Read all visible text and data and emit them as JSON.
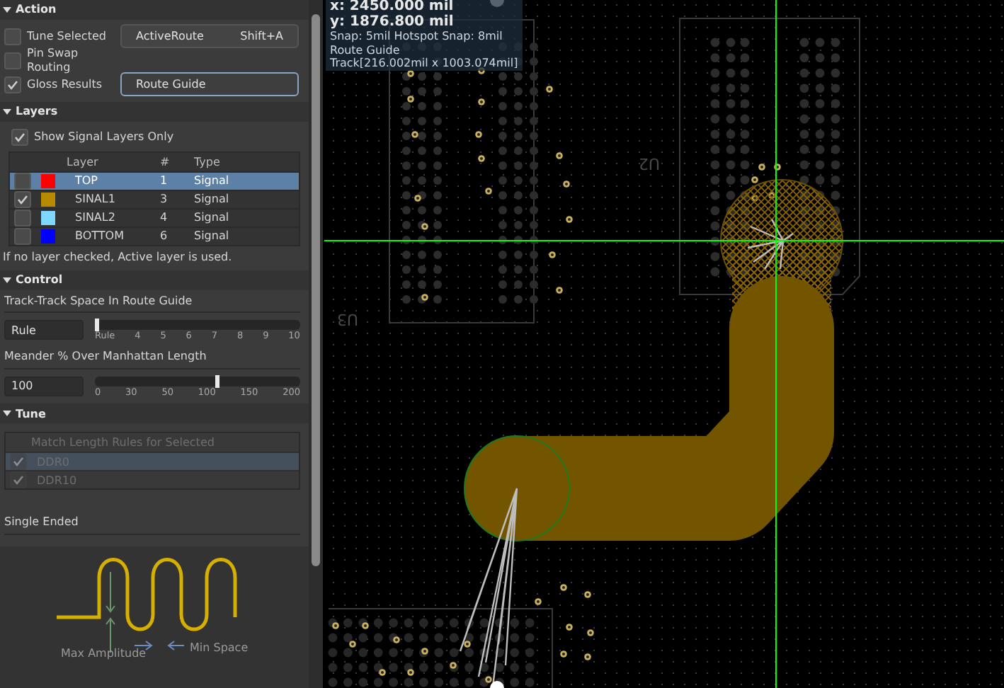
{
  "action": {
    "title": "Action",
    "expanded": true,
    "options": [
      {
        "label": "Tune Selected",
        "checked": false
      },
      {
        "label": "Pin Swap Routing",
        "checked": false
      },
      {
        "label": "Gloss Results",
        "checked": true
      }
    ],
    "buttons": [
      {
        "label": "ActiveRoute",
        "shortcut": "Shift+A",
        "selected": false
      },
      {
        "label": "Route Guide",
        "selected": true
      }
    ]
  },
  "layers": {
    "title": "Layers",
    "expanded": true,
    "show_signal_only": {
      "label": "Show Signal Layers Only",
      "checked": true
    },
    "columns": [
      "Layer",
      "#",
      "Type"
    ],
    "rows": [
      {
        "checked": false,
        "color": "#ff0000",
        "name": "TOP",
        "number": "1",
        "type": "Signal",
        "selected": true
      },
      {
        "checked": true,
        "color": "#b88a00",
        "name": "SINAL1",
        "number": "3",
        "type": "Signal",
        "selected": false
      },
      {
        "checked": false,
        "color": "#7fd8ff",
        "name": "SINAL2",
        "number": "4",
        "type": "Signal",
        "selected": false
      },
      {
        "checked": false,
        "color": "#0000ff",
        "name": "BOTTOM",
        "number": "6",
        "type": "Signal",
        "selected": false
      }
    ],
    "note": "If no layer checked, Active layer is used."
  },
  "control": {
    "title": "Control",
    "expanded": true,
    "settings": [
      {
        "label": "Track-Track Space In Route Guide",
        "value": "Rule",
        "level": 0,
        "ticks": [
          "Rule",
          "4",
          "5",
          "6",
          "7",
          "8",
          "9",
          "10"
        ]
      },
      {
        "label": "Meander % Over Manhattan Length",
        "value": "100",
        "level": 0.6,
        "ticks": [
          "0",
          "30",
          "50",
          "100",
          "150",
          "200"
        ]
      }
    ]
  },
  "tune": {
    "title": "Tune",
    "expanded": true,
    "disabled": true,
    "column": "Match Length Rules for Selected",
    "rows": [
      {
        "name": "DDR0",
        "checked": true,
        "selected": true
      },
      {
        "name": "DDR10",
        "checked": true,
        "selected": false
      }
    ],
    "mode": "Single Ended",
    "diagram_labels": [
      "Max Amplitude",
      "Min Space"
    ]
  },
  "canvas": {
    "readout": [
      "x:  2450.000 mil",
      "y:  1876.800 mil"
    ],
    "info": [
      "Snap: 5mil Hotspot Snap: 8mil",
      "Route Guide",
      "Track[216.002mil x 1003.074mil]"
    ],
    "designators": [
      "U3",
      "U2"
    ]
  }
}
